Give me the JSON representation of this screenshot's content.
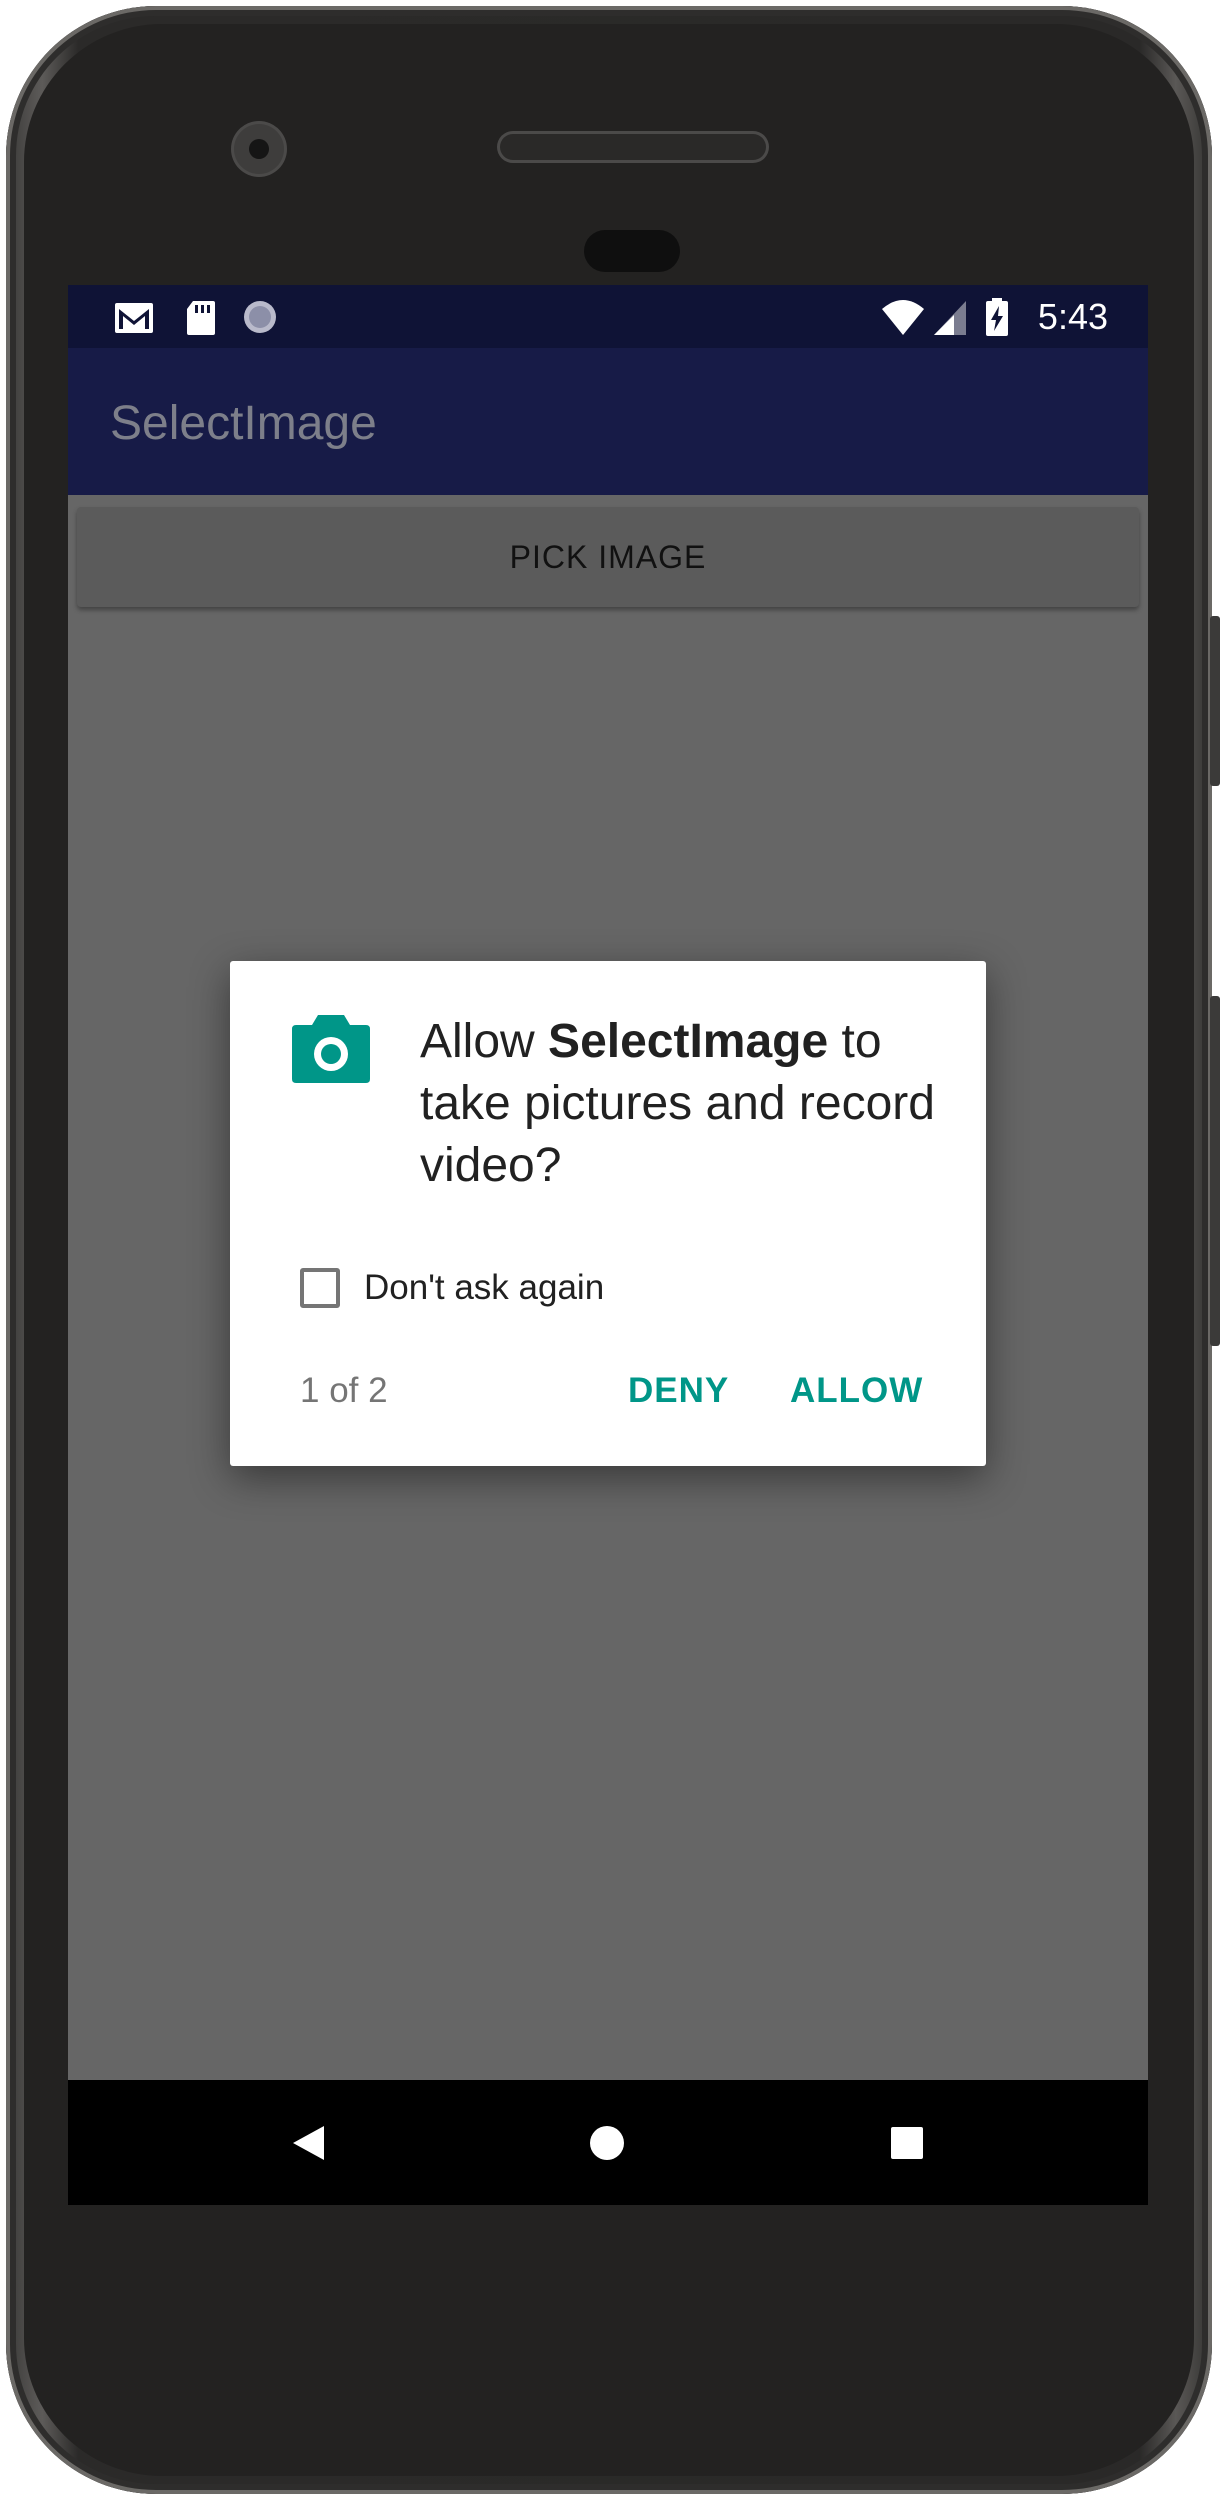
{
  "status_bar": {
    "time": "5:43",
    "icons": [
      "gmail-icon",
      "sd-card-icon",
      "sync-icon",
      "wifi-icon",
      "signal-icon",
      "battery-charging-icon"
    ]
  },
  "app_bar": {
    "title": "SelectImage"
  },
  "main": {
    "pick_button_label": "PICK IMAGE"
  },
  "dialog": {
    "icon": "camera-icon",
    "message_prefix": "Allow ",
    "app_name": "SelectImage",
    "message_suffix": " to take pictures and record video?",
    "checkbox_label": "Don't ask again",
    "checkbox_checked": false,
    "page_indicator": "1 of 2",
    "deny_label": "DENY",
    "allow_label": "ALLOW"
  },
  "nav_bar": {
    "icons": [
      "back-icon",
      "home-icon",
      "recents-icon"
    ]
  },
  "colors": {
    "status_bar": "#0f1336",
    "app_bar": "#171b47",
    "accent": "#009688",
    "scrim": "#666666"
  }
}
